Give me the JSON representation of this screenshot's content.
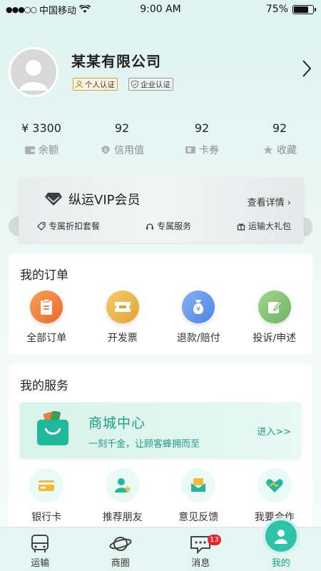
{
  "status_bar": {
    "carrier": "中国移动",
    "time": "9:00 AM",
    "battery": "75%",
    "battery_level": 0.75
  },
  "profile": {
    "company": "某某有限公司",
    "badges": [
      "个人认证",
      "企业认证"
    ]
  },
  "stats": [
    {
      "value": "¥ 3300",
      "label": "余额",
      "icon": "wallet-icon"
    },
    {
      "value": "92",
      "label": "信用值",
      "icon": "credit-icon"
    },
    {
      "value": "92",
      "label": "卡券",
      "icon": "coupon-icon"
    },
    {
      "value": "92",
      "label": "收藏",
      "icon": "star-icon"
    }
  ],
  "vip": {
    "title": "纵运VIP会员",
    "details": "查看详情 ›",
    "perks": [
      "专属折扣套餐",
      "专属服务",
      "运输大礼包"
    ]
  },
  "orders": {
    "title": "我的订单",
    "items": [
      {
        "label": "全部订单",
        "icon": "clipboard-icon",
        "color": "#f0782f"
      },
      {
        "label": "开发票",
        "icon": "ticket-icon",
        "color": "#e9b141"
      },
      {
        "label": "退款/赔付",
        "icon": "moneybag-icon",
        "color": "#5b93ea"
      },
      {
        "label": "投诉/申述",
        "icon": "edit-icon",
        "color": "#7cbf6e"
      }
    ]
  },
  "services": {
    "title": "我的服务",
    "mall": {
      "title": "商城中心",
      "subtitle": "一刻千金，让顾客蜂拥而至",
      "enter": "进入>>"
    },
    "items": [
      {
        "label": "银行卡",
        "icon": "bank-card-icon"
      },
      {
        "label": "推荐朋友",
        "icon": "recommend-friend-icon"
      },
      {
        "label": "意见反馈",
        "icon": "feedback-icon"
      },
      {
        "label": "我要合作",
        "icon": "handshake-icon"
      }
    ]
  },
  "tabbar": {
    "tabs": [
      {
        "label": "运输",
        "icon": "truck-icon"
      },
      {
        "label": "商圈",
        "icon": "planet-icon"
      },
      {
        "label": "消息",
        "icon": "message-icon",
        "badge": "13"
      },
      {
        "label": "我的",
        "icon": "user-icon",
        "active": true
      }
    ]
  },
  "colors": {
    "accent": "#2cc3a9",
    "accent_text": "#1a9c86",
    "badge": "#e8232f"
  }
}
